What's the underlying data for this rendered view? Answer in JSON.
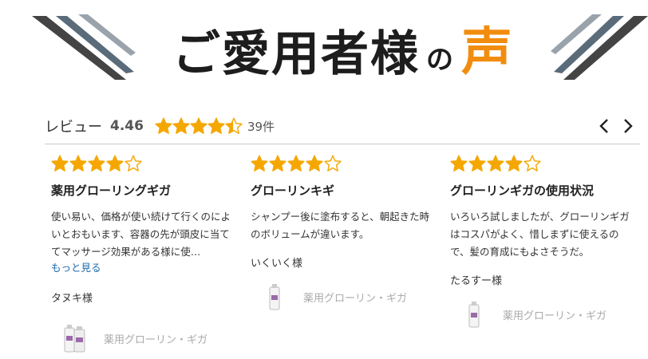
{
  "banner": {
    "title_main": "ご愛用者様",
    "title_no": "の",
    "title_voice": "声",
    "accent": "#f28c0f"
  },
  "review_summary": {
    "label": "レビュー",
    "average": "4.46",
    "rating": 4.46,
    "count": "39件",
    "prev_icon": "chevron-left-icon",
    "next_icon": "chevron-right-icon"
  },
  "reviews": [
    {
      "rating": 4,
      "title": "薬用グローリングギガ",
      "body": "使い易い、価格が使い続けて行くのによいとおもいます、容器の先が頭皮に当ててマッサージ効果がある様に使…",
      "more": "もっと見る",
      "author": "タヌキ様",
      "product": "薬用グローリン・ギガ"
    },
    {
      "rating": 4,
      "title": "グローリンキギ",
      "body": "シャンプー後に塗布すると、朝起きた時のボリュームが違います。",
      "author": "いくいく様",
      "product": "薬用グローリン・ギガ"
    },
    {
      "rating": 4,
      "title": "グローリンギガの使用状況",
      "body": "いろいろ試しましたが、グローリンギガはコスパがよく、惜しまずに使えるので、髪の育成にもよさそうだ。",
      "author": "たるすー様",
      "product": "薬用グローリン・ギガ"
    }
  ],
  "colors": {
    "star": "#f5a700",
    "star_empty": "#f5a700",
    "link": "#1a6aad"
  }
}
